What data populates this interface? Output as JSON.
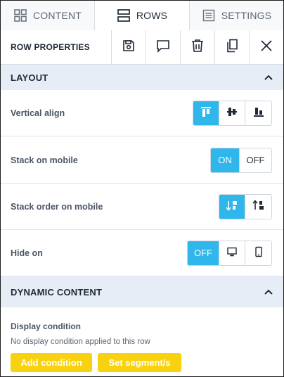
{
  "tabs": [
    {
      "label": "CONTENT",
      "icon": "grid-icon",
      "active": false
    },
    {
      "label": "ROWS",
      "icon": "rows-icon",
      "active": true
    },
    {
      "label": "SETTINGS",
      "icon": "settings-list-icon",
      "active": false
    }
  ],
  "toolbar": {
    "title": "ROW PROPERTIES",
    "buttons": [
      "save-icon",
      "comment-icon",
      "trash-icon",
      "duplicate-icon",
      "close-icon"
    ]
  },
  "layout": {
    "header": "LAYOUT",
    "rows": {
      "vertical_align": {
        "label": "Vertical align",
        "options": [
          "top",
          "middle",
          "bottom"
        ],
        "selected": "top"
      },
      "stack_on_mobile": {
        "label": "Stack on mobile",
        "on_label": "ON",
        "off_label": "OFF",
        "selected": "ON"
      },
      "stack_order": {
        "label": "Stack order on mobile",
        "options": [
          "normal",
          "reverse"
        ],
        "selected": "normal"
      },
      "hide_on": {
        "label": "Hide on",
        "off_label": "OFF",
        "options": [
          "OFF",
          "desktop",
          "mobile"
        ],
        "selected": "OFF"
      }
    }
  },
  "dynamic": {
    "header": "DYNAMIC CONTENT",
    "condition_title": "Display condition",
    "condition_desc": "No display condition applied to this row",
    "add_condition_label": "Add condition",
    "set_segment_label": "Set segment/s"
  },
  "colors": {
    "accent": "#2fb6ea",
    "section_bg": "#e7edf6",
    "yellow": "#f8d210"
  }
}
